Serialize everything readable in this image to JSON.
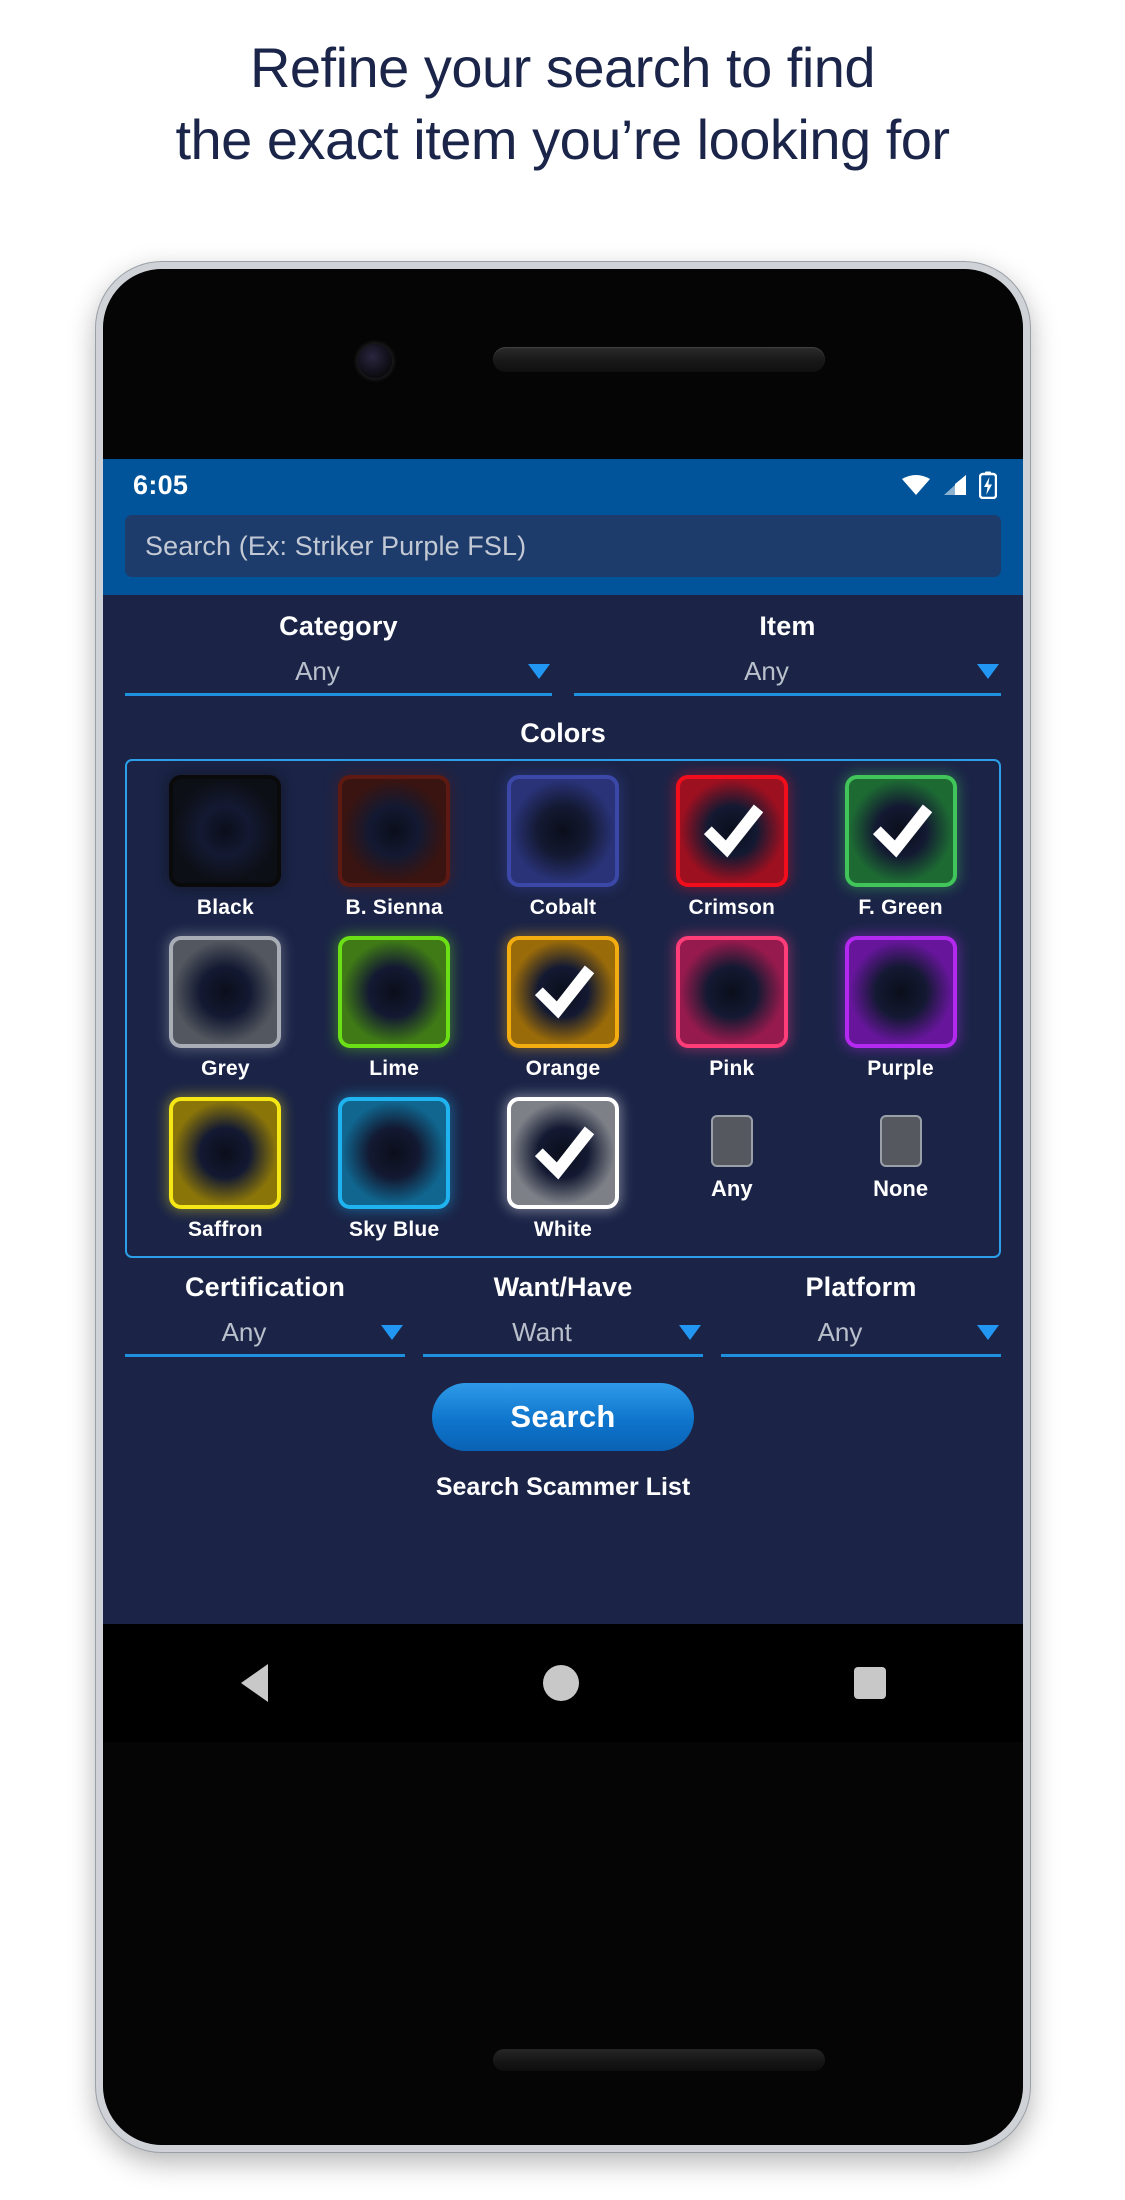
{
  "headline": {
    "line1": "Refine your search to find",
    "line2": "the exact item you’re looking for"
  },
  "colors": {
    "accent_blue": "#2196f3",
    "statusbar_blue": "#01549a",
    "screen_bg": "#1b2447",
    "headline_navy": "#1b2449"
  },
  "status_bar": {
    "time": "6:05",
    "icons": [
      "wifi-icon",
      "cell-signal-icon",
      "battery-charging-icon"
    ]
  },
  "search": {
    "placeholder": "Search (Ex: Striker Purple FSL)",
    "value": ""
  },
  "filters_top": [
    {
      "label": "Category",
      "value": "Any"
    },
    {
      "label": "Item",
      "value": "Any"
    }
  ],
  "colors_section": {
    "title": "Colors",
    "rows": [
      [
        {
          "name": "Black",
          "swatch": "#0d0f16",
          "border": "#0a0a0a",
          "checked": false
        },
        {
          "name": "B. Sienna",
          "swatch": "#3a1410",
          "border": "#5e1a12",
          "checked": false
        },
        {
          "name": "Cobalt",
          "swatch": "#2a3378",
          "border": "#3b48a8",
          "checked": false
        },
        {
          "name": "Crimson",
          "swatch": "#9c1020",
          "border": "#f20d1c",
          "checked": true
        },
        {
          "name": "F. Green",
          "swatch": "#1d6b33",
          "border": "#41c45a",
          "checked": true
        }
      ],
      [
        {
          "name": "Grey",
          "swatch": "#53575f",
          "border": "#a9aeb6",
          "checked": false
        },
        {
          "name": "Lime",
          "swatch": "#3f7a16",
          "border": "#6ce016",
          "checked": false
        },
        {
          "name": "Orange",
          "swatch": "#9a6b09",
          "border": "#f4ad11",
          "checked": true
        },
        {
          "name": "Pink",
          "swatch": "#961a4d",
          "border": "#ff3d78",
          "checked": false
        },
        {
          "name": "Purple",
          "swatch": "#67169c",
          "border": "#b429ef",
          "checked": false
        }
      ],
      [
        {
          "name": "Saffron",
          "swatch": "#8a7509",
          "border": "#f5e616",
          "checked": false
        },
        {
          "name": "Sky Blue",
          "swatch": "#10668f",
          "border": "#1fb4f0",
          "checked": false
        },
        {
          "name": "White",
          "swatch": "#7d8087",
          "border": "#ffffff",
          "checked": true
        }
      ]
    ],
    "extra_toggles": [
      {
        "label": "Any",
        "checked": false
      },
      {
        "label": "None",
        "checked": false
      }
    ]
  },
  "filters_bottom": [
    {
      "label": "Certification",
      "value": "Any"
    },
    {
      "label": "Want/Have",
      "value": "Want"
    },
    {
      "label": "Platform",
      "value": "Any"
    }
  ],
  "actions": {
    "search_button": "Search",
    "scammer_link": "Search Scammer List"
  },
  "nav_bar": {
    "items": [
      "back-nav-icon",
      "home-nav-icon",
      "recents-nav-icon"
    ]
  }
}
